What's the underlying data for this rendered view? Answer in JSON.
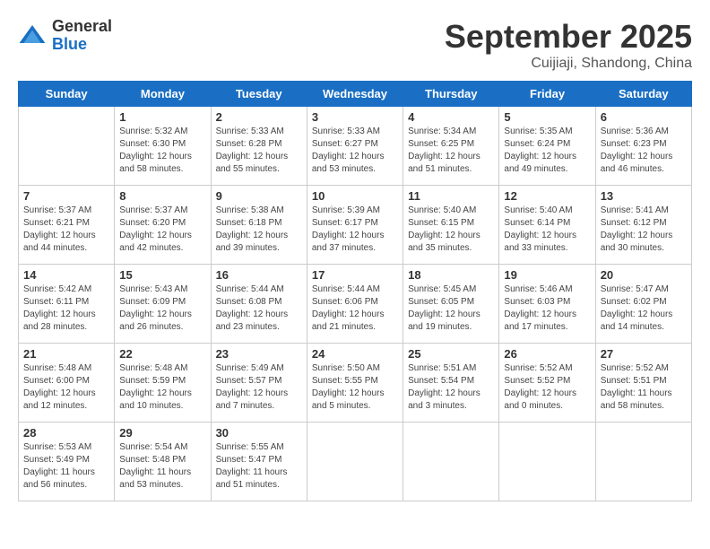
{
  "header": {
    "logo_general": "General",
    "logo_blue": "Blue",
    "month_title": "September 2025",
    "location": "Cuijiaji, Shandong, China"
  },
  "weekdays": [
    "Sunday",
    "Monday",
    "Tuesday",
    "Wednesday",
    "Thursday",
    "Friday",
    "Saturday"
  ],
  "weeks": [
    [
      {
        "day": "",
        "content": ""
      },
      {
        "day": "1",
        "content": "Sunrise: 5:32 AM\nSunset: 6:30 PM\nDaylight: 12 hours\nand 58 minutes."
      },
      {
        "day": "2",
        "content": "Sunrise: 5:33 AM\nSunset: 6:28 PM\nDaylight: 12 hours\nand 55 minutes."
      },
      {
        "day": "3",
        "content": "Sunrise: 5:33 AM\nSunset: 6:27 PM\nDaylight: 12 hours\nand 53 minutes."
      },
      {
        "day": "4",
        "content": "Sunrise: 5:34 AM\nSunset: 6:25 PM\nDaylight: 12 hours\nand 51 minutes."
      },
      {
        "day": "5",
        "content": "Sunrise: 5:35 AM\nSunset: 6:24 PM\nDaylight: 12 hours\nand 49 minutes."
      },
      {
        "day": "6",
        "content": "Sunrise: 5:36 AM\nSunset: 6:23 PM\nDaylight: 12 hours\nand 46 minutes."
      }
    ],
    [
      {
        "day": "7",
        "content": "Sunrise: 5:37 AM\nSunset: 6:21 PM\nDaylight: 12 hours\nand 44 minutes."
      },
      {
        "day": "8",
        "content": "Sunrise: 5:37 AM\nSunset: 6:20 PM\nDaylight: 12 hours\nand 42 minutes."
      },
      {
        "day": "9",
        "content": "Sunrise: 5:38 AM\nSunset: 6:18 PM\nDaylight: 12 hours\nand 39 minutes."
      },
      {
        "day": "10",
        "content": "Sunrise: 5:39 AM\nSunset: 6:17 PM\nDaylight: 12 hours\nand 37 minutes."
      },
      {
        "day": "11",
        "content": "Sunrise: 5:40 AM\nSunset: 6:15 PM\nDaylight: 12 hours\nand 35 minutes."
      },
      {
        "day": "12",
        "content": "Sunrise: 5:40 AM\nSunset: 6:14 PM\nDaylight: 12 hours\nand 33 minutes."
      },
      {
        "day": "13",
        "content": "Sunrise: 5:41 AM\nSunset: 6:12 PM\nDaylight: 12 hours\nand 30 minutes."
      }
    ],
    [
      {
        "day": "14",
        "content": "Sunrise: 5:42 AM\nSunset: 6:11 PM\nDaylight: 12 hours\nand 28 minutes."
      },
      {
        "day": "15",
        "content": "Sunrise: 5:43 AM\nSunset: 6:09 PM\nDaylight: 12 hours\nand 26 minutes."
      },
      {
        "day": "16",
        "content": "Sunrise: 5:44 AM\nSunset: 6:08 PM\nDaylight: 12 hours\nand 23 minutes."
      },
      {
        "day": "17",
        "content": "Sunrise: 5:44 AM\nSunset: 6:06 PM\nDaylight: 12 hours\nand 21 minutes."
      },
      {
        "day": "18",
        "content": "Sunrise: 5:45 AM\nSunset: 6:05 PM\nDaylight: 12 hours\nand 19 minutes."
      },
      {
        "day": "19",
        "content": "Sunrise: 5:46 AM\nSunset: 6:03 PM\nDaylight: 12 hours\nand 17 minutes."
      },
      {
        "day": "20",
        "content": "Sunrise: 5:47 AM\nSunset: 6:02 PM\nDaylight: 12 hours\nand 14 minutes."
      }
    ],
    [
      {
        "day": "21",
        "content": "Sunrise: 5:48 AM\nSunset: 6:00 PM\nDaylight: 12 hours\nand 12 minutes."
      },
      {
        "day": "22",
        "content": "Sunrise: 5:48 AM\nSunset: 5:59 PM\nDaylight: 12 hours\nand 10 minutes."
      },
      {
        "day": "23",
        "content": "Sunrise: 5:49 AM\nSunset: 5:57 PM\nDaylight: 12 hours\nand 7 minutes."
      },
      {
        "day": "24",
        "content": "Sunrise: 5:50 AM\nSunset: 5:55 PM\nDaylight: 12 hours\nand 5 minutes."
      },
      {
        "day": "25",
        "content": "Sunrise: 5:51 AM\nSunset: 5:54 PM\nDaylight: 12 hours\nand 3 minutes."
      },
      {
        "day": "26",
        "content": "Sunrise: 5:52 AM\nSunset: 5:52 PM\nDaylight: 12 hours\nand 0 minutes."
      },
      {
        "day": "27",
        "content": "Sunrise: 5:52 AM\nSunset: 5:51 PM\nDaylight: 11 hours\nand 58 minutes."
      }
    ],
    [
      {
        "day": "28",
        "content": "Sunrise: 5:53 AM\nSunset: 5:49 PM\nDaylight: 11 hours\nand 56 minutes."
      },
      {
        "day": "29",
        "content": "Sunrise: 5:54 AM\nSunset: 5:48 PM\nDaylight: 11 hours\nand 53 minutes."
      },
      {
        "day": "30",
        "content": "Sunrise: 5:55 AM\nSunset: 5:47 PM\nDaylight: 11 hours\nand 51 minutes."
      },
      {
        "day": "",
        "content": ""
      },
      {
        "day": "",
        "content": ""
      },
      {
        "day": "",
        "content": ""
      },
      {
        "day": "",
        "content": ""
      }
    ]
  ]
}
